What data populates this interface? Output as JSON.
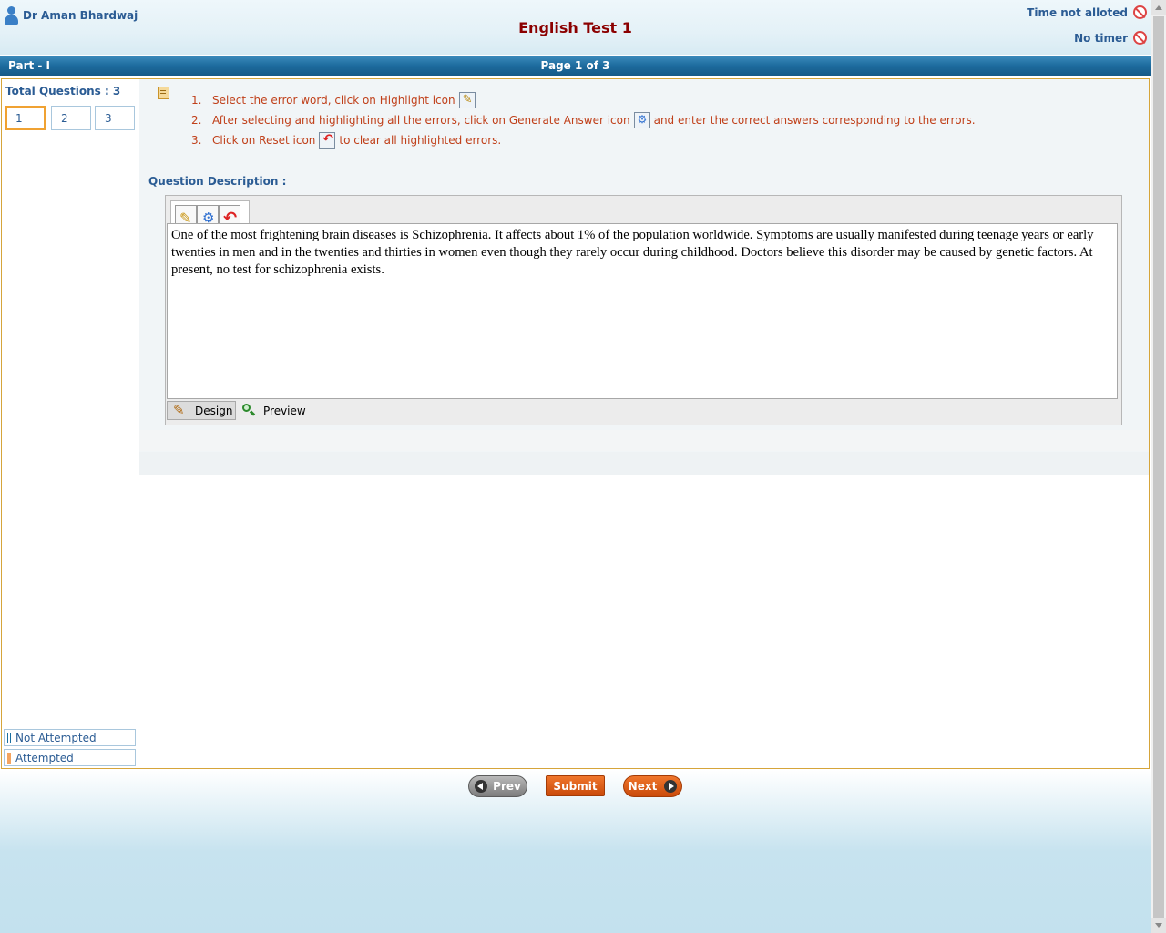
{
  "header": {
    "user_name": "Dr Aman Bhardwaj",
    "title": "English Test 1",
    "time_status": "Time not alloted",
    "timer_status": "No timer"
  },
  "partbar": {
    "part": "Part - I",
    "page": "Page 1 of 3"
  },
  "sidebar": {
    "total_questions": "Total Questions : 3",
    "questions": [
      "1",
      "2",
      "3"
    ],
    "active_question": "1",
    "legend": {
      "not_attempted": "Not Attempted",
      "attempted": "Attempted",
      "not_attempted_color": "#1a6fa0",
      "attempted_color": "#f4a460"
    }
  },
  "instructions": [
    {
      "num": "1.",
      "before": "Select the error word, click on Highlight icon",
      "icon": "highlight-icon",
      "after": ""
    },
    {
      "num": "2.",
      "before": "After selecting and highlighting all the errors, click on Generate Answer icon",
      "icon": "generate-answer-icon",
      "after": "and enter the correct answers corresponding to the errors."
    },
    {
      "num": "3.",
      "before": "Click on Reset icon",
      "icon": "reset-icon",
      "after": "to clear all highlighted errors."
    }
  ],
  "question": {
    "label": "Question Description :",
    "text": "One of the most frightening brain diseases is Schizophrenia. It affects about 1% of the population worldwide. Symptoms are usually manifested during teenage years or early twenties in men and in the twenties and thirties in women even though they rarely occur during childhood. Doctors believe this disorder may be caused by genetic factors. At present, no test for schizophrenia exists."
  },
  "editor": {
    "design_label": "Design",
    "preview_label": "Preview"
  },
  "footer": {
    "prev_label": "Prev",
    "submit_label": "Submit",
    "next_label": "Next"
  },
  "colors": {
    "accent": "#1d6b9e",
    "title": "#8b0000",
    "instruction_text": "#c0401a",
    "button_orange": "#e0601a"
  }
}
